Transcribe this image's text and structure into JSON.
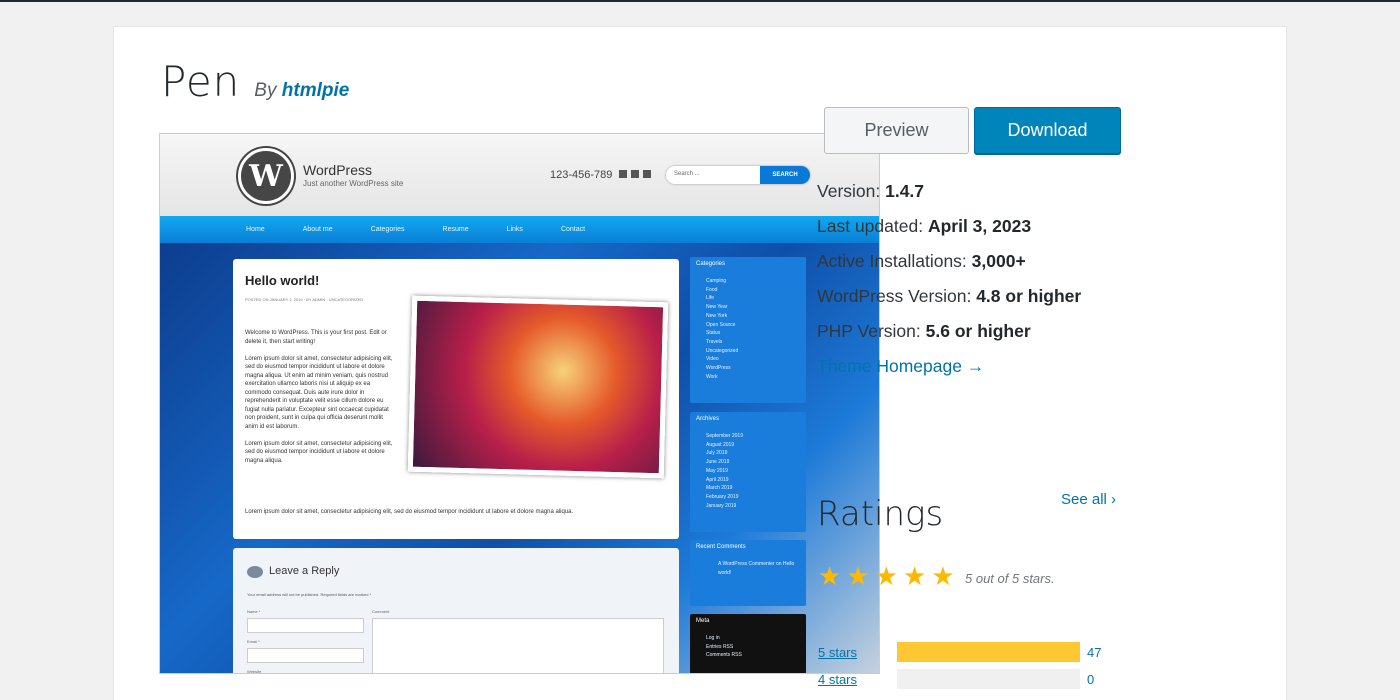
{
  "theme": {
    "name": "Pen",
    "by": "By",
    "author": "htmlpie"
  },
  "screenshot": {
    "site_title": "WordPress",
    "tagline": "Just another WordPress site",
    "phone": "123-456-789",
    "search_placeholder": "Search ...",
    "search_button": "SEARCH",
    "nav": [
      "Home",
      "About me",
      "Categories",
      "Resume",
      "Links",
      "Contact"
    ],
    "post_title": "Hello world!",
    "post_meta": "POSTED ON JANUARY 1, 2019 · BY ADMIN · UNCATEGORIZED",
    "post_intro": "Welcome to WordPress. This is your first post. Edit or delete it, then start writing!",
    "post_para1": "Lorem ipsum dolor sit amet, consectetur adipisicing elit, sed do eiusmod tempor incididunt ut labore et dolore magna aliqua. Ut enim ad minim veniam, quis nostrud exercitation ullamco laboris nisi ut aliquip ex ea commodo consequat. Duis aute irure dolor in reprehenderit in voluptate velit esse cillum dolore eu fugiat nulla pariatur. Excepteur sint occaecat cupidatat non proident, sunt in culpa qui officia deserunt mollit anim id est laborum.",
    "post_para2": "Lorem ipsum dolor sit amet, consectetur adipisicing elit, sed do eiusmod tempor incididunt ut labore et dolore magna aliqua.",
    "post_para3": "Lorem ipsum dolor sit amet, consectetur adipisicing elit, sed do eiusmod tempor incididunt ut labore et dolore magna aliqua.",
    "categories_title": "Categories",
    "categories": [
      "Camping",
      "Food",
      "Life",
      "New Year",
      "New York",
      "Open Source",
      "Status",
      "Travels",
      "Uncategorized",
      "Video",
      "WordPress",
      "Work"
    ],
    "archives_title": "Archives",
    "archives": [
      "September 2019",
      "August 2019",
      "July 2019",
      "June 2019",
      "May 2019",
      "April 2019",
      "March 2019",
      "February 2019",
      "January 2019"
    ],
    "recent_comments_title": "Recent Comments",
    "recent_comment": "A WordPress Commenter on Hello world!",
    "meta_title": "Meta",
    "meta_links": [
      "Log in",
      "Entries RSS",
      "Comments RSS"
    ],
    "reply_title": "Leave a Reply",
    "reply_note": "Your email address will not be published. Required fields are marked *",
    "name_label": "Name *",
    "email_label": "Email *",
    "website_label": "Website",
    "comment_label": "Comment"
  },
  "actions": {
    "preview": "Preview",
    "download": "Download"
  },
  "details": {
    "version_label": "Version:",
    "version": "1.4.7",
    "updated_label": "Last updated:",
    "updated": "April 3, 2023",
    "installs_label": "Active Installations:",
    "installs": "3,000+",
    "wp_label": "WordPress Version:",
    "wp": "4.8 or higher",
    "php_label": "PHP Version:",
    "php": "5.6 or higher",
    "homepage": "Theme Homepage →"
  },
  "ratings": {
    "title": "Ratings",
    "see_all": "See all",
    "stars_text": "5 out of 5 stars.",
    "rating": 5,
    "rows": [
      {
        "label": "5 stars",
        "count": "47",
        "fraction": 1.0
      },
      {
        "label": "4 stars",
        "count": "0",
        "fraction": 0.0
      }
    ]
  },
  "colors": {
    "accent": "#0073aa",
    "download": "#0085ba",
    "star": "#ffb900",
    "bar": "#ffc733"
  }
}
